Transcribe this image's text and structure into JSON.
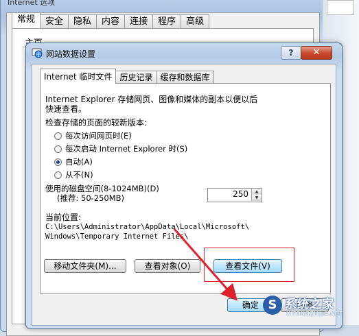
{
  "background_window": {
    "title": "Internet 选项",
    "tabs": [
      "常规",
      "安全",
      "隐私",
      "内容",
      "连接",
      "程序",
      "高级"
    ],
    "active_tab": 0,
    "label_partial": "主页"
  },
  "dialog": {
    "title": "网站数据设置",
    "help_symbol": "?",
    "close_symbol": "✕",
    "tabs": [
      "Internet 临时文件",
      "历史记录",
      "缓存和数据库"
    ],
    "active_tab": 0,
    "description_line1": "Internet Explorer 存储网页、图像和媒体的副本以便以后",
    "description_line2": "快速查看。",
    "check_label": "检查存储的页面的较新版本:",
    "radio_options": [
      {
        "label": "每次访问网页时(E)",
        "checked": false
      },
      {
        "label": "每次启动 Internet Explorer 时(S)",
        "checked": false
      },
      {
        "label": "自动(A)",
        "checked": true
      },
      {
        "label": "从不(N)",
        "checked": false
      }
    ],
    "disk_space_label": "使用的磁盘空间(8-1024MB)(D)",
    "disk_space_recommend": "(推荐: 50-250MB)",
    "disk_space_value": "250",
    "location_label": "当前位置:",
    "location_line1": "C:\\Users\\Administrator\\AppData\\Local\\Microsoft\\",
    "location_line2": "Windows\\Temporary Internet Files\\",
    "buttons": {
      "move_folder": "移动文件夹(M)...",
      "view_objects": "查看对象(O)",
      "view_files": "查看文件(V)",
      "ok": "确定",
      "cancel": "取消"
    }
  },
  "watermark": {
    "logo_char": "S",
    "text": "系统之家",
    "subtext": "XITONGZHIJIA.NET"
  },
  "colors": {
    "highlight": "#e0202a",
    "arrow": "#e0202a",
    "title_gradient": "#b3cae6",
    "close_button": "#c74a2c"
  }
}
